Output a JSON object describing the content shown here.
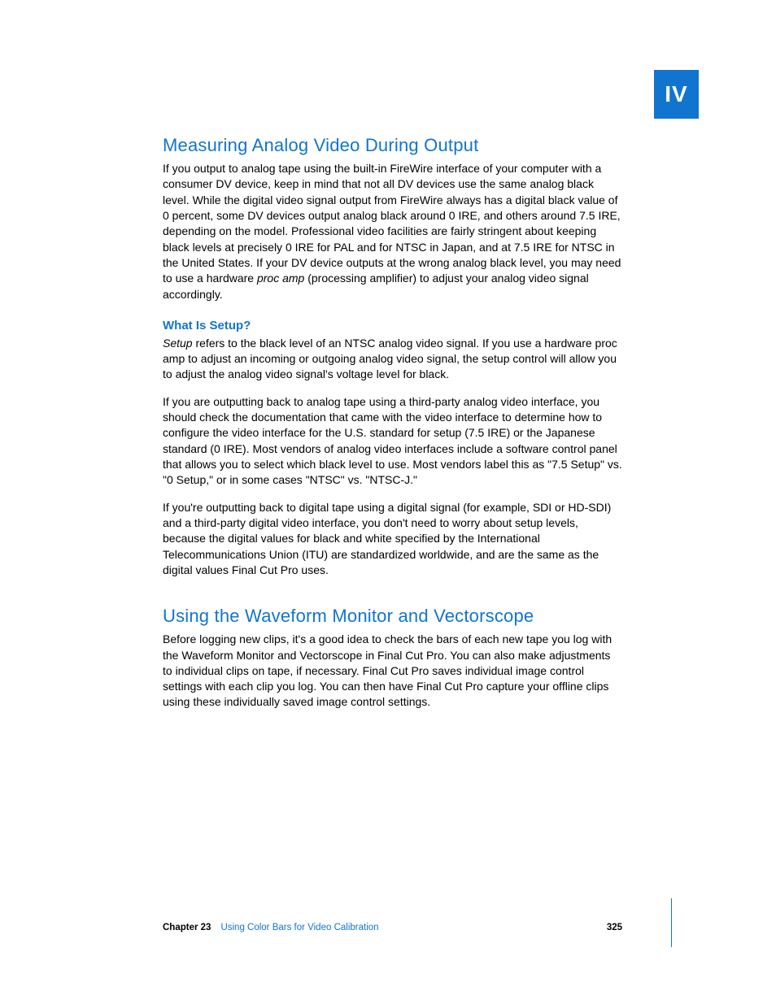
{
  "part_tab": "IV",
  "section1": {
    "heading": "Measuring Analog Video During Output",
    "p1_a": "If you output to analog tape using the built-in FireWire interface of your computer with a consumer DV device, keep in mind that not all DV devices use the same analog black level. While the digital video signal output from FireWire always has a digital black value of 0 percent, some DV devices output analog black around 0 IRE, and others around 7.5 IRE, depending on the model. Professional video facilities are fairly stringent about keeping black levels at precisely 0 IRE for PAL and for NTSC in Japan, and at 7.5 IRE for NTSC in the United States. If your DV device outputs at the wrong analog black level, you may need to use a hardware ",
    "p1_em": "proc amp",
    "p1_b": " (processing amplifier) to adjust your analog video signal accordingly."
  },
  "subsection": {
    "heading": "What Is Setup?",
    "p1_em": "Setup",
    "p1_rest": " refers to the black level of an NTSC analog video signal. If you use a hardware proc amp to adjust an incoming or outgoing analog video signal, the setup control will allow you to adjust the analog video signal's voltage level for black.",
    "p2": "If you are outputting back to analog tape using a third-party analog video interface, you should check the documentation that came with the video interface to determine how to configure the video interface for the U.S. standard for setup (7.5 IRE) or the Japanese standard (0 IRE). Most vendors of analog video interfaces include a software control panel that allows you to select which black level to use. Most vendors label this as \"7.5 Setup\" vs. \"0 Setup,\" or in some cases \"NTSC\" vs. \"NTSC-J.\"",
    "p3": "If you're outputting back to digital tape using a digital signal (for example, SDI or HD-SDI) and a third-party digital video interface, you don't need to worry about setup levels, because the digital values for black and white specified by the International Telecommunications Union (ITU) are standardized worldwide, and are the same as the digital values Final Cut Pro uses."
  },
  "section2": {
    "heading": "Using the Waveform Monitor and Vectorscope",
    "p1": "Before logging new clips, it's a good idea to check the bars of each new tape you log with the Waveform Monitor and Vectorscope in Final Cut Pro. You can also make adjustments to individual clips on tape, if necessary. Final Cut Pro saves individual image control settings with each clip you log. You can then have Final Cut Pro capture your offline clips using these individually saved image control settings."
  },
  "footer": {
    "chapter": "Chapter 23",
    "title": "Using Color Bars for Video Calibration",
    "page": "325"
  }
}
